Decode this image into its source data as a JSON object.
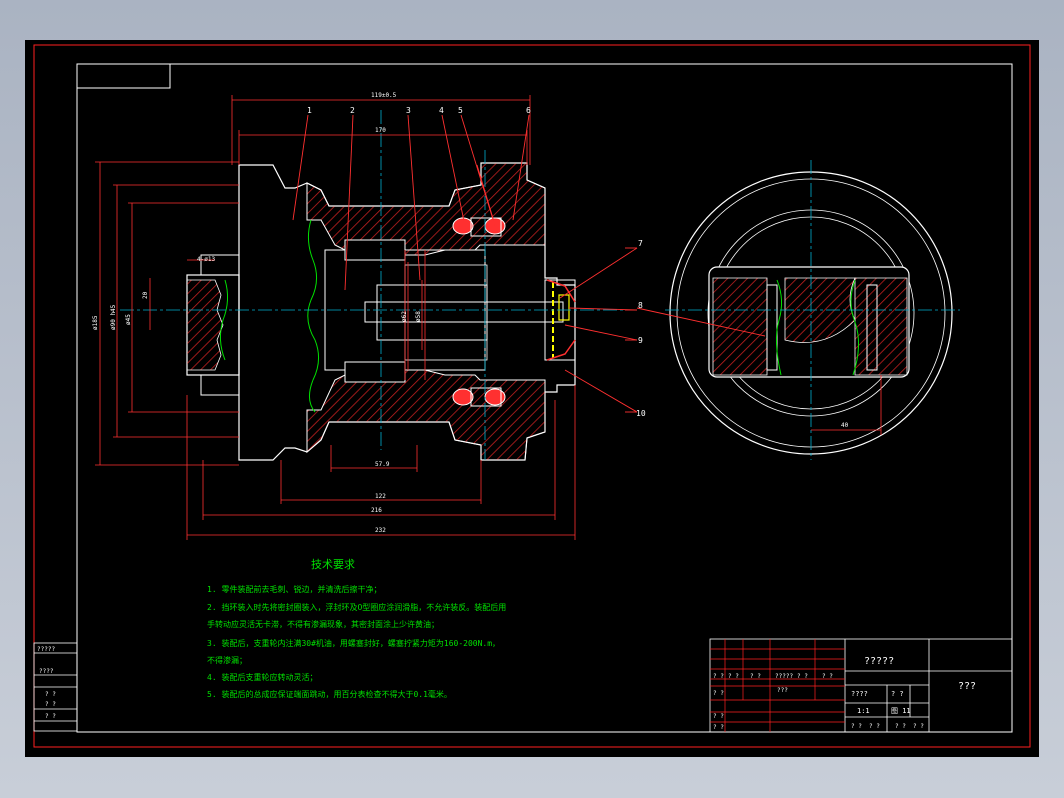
{
  "colors": {
    "background": "#000000",
    "frame": "#ff2020",
    "outline": "#ffffff",
    "hatch": "#c02020",
    "center_line": "#00b0d0",
    "dimension": "#ff3030",
    "text": "#00e000",
    "highlight": "#ffff00"
  },
  "balloons": [
    "1",
    "2",
    "3",
    "4",
    "5",
    "6",
    "7",
    "8",
    "9",
    "10"
  ],
  "dimensions": {
    "top_total": "119±0.5",
    "top_inner": "170",
    "left_1": "ø185",
    "left_2": "ø90 h45",
    "left_3": "ø45",
    "small_bore": "4-ø13",
    "height_20": "20",
    "bottom_1": "57.9",
    "bottom_2": "122",
    "bottom_3": "216",
    "bottom_total": "232",
    "shaft_1": "ø62",
    "shaft_2": "ø58",
    "side_40": "40"
  },
  "tech_requirements": {
    "title": "技术要求",
    "lines": [
      "1. 零件装配前去毛刺、锐边，并清洗后擦干净；",
      "2. 挡环装入时先将密封圈装入，浮封环及O型圈应涂润滑脂，不允许装反。装配后用",
      "   手转动应灵活无卡滞，不得有渗漏现象，其密封面涂上少许黄油；",
      "3. 装配后，支重轮内注满30#机油，用螺塞封好，螺塞拧紧力矩为160-200N.m，",
      "   不得渗漏；",
      "4. 装配后支重轮应转动灵活；",
      "5. 装配后的总成应保证端面跳动，用百分表检查不得大于0.1毫米。"
    ]
  },
  "left_strip": [
    "?????",
    "????",
    "? ?",
    "? ?",
    "? ?"
  ],
  "title_block": {
    "drawing_name": "?????",
    "company": "???",
    "rev_cells": [
      "? ?",
      "? ?",
      "? ?",
      "?????",
      "? ?",
      "? ?"
    ],
    "role_cells": [
      "? ?",
      "? ?",
      "? ?",
      "???"
    ],
    "scale_label": "????",
    "qty_label": "? ?",
    "scale_value": "1:1",
    "sheet_info": "图 11",
    "sheet_row": [
      "? ?",
      "? ?",
      "? ?",
      "? ?"
    ]
  }
}
